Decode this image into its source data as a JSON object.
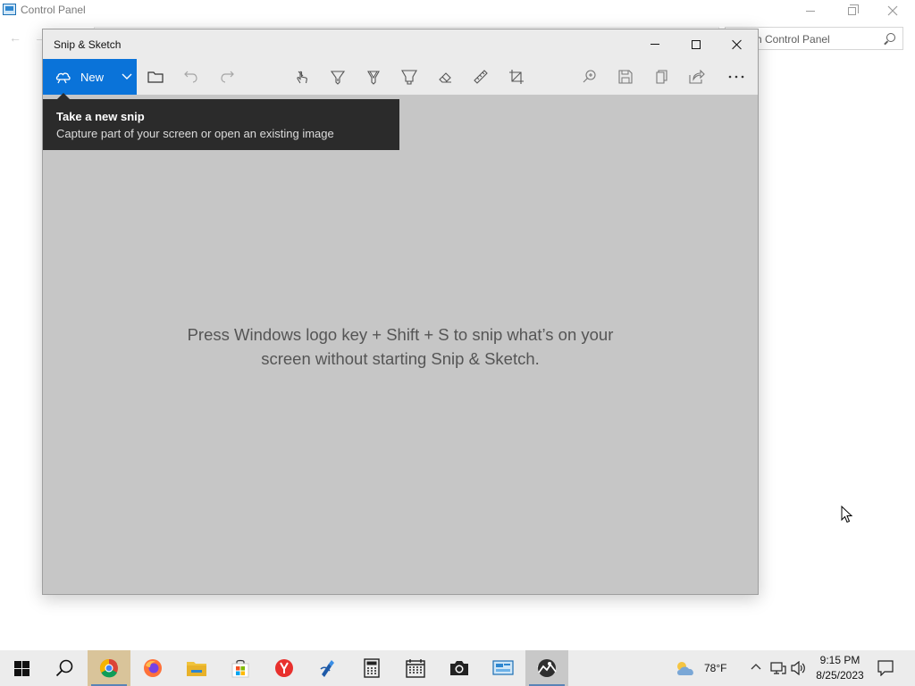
{
  "background_window": {
    "title": "Control Panel",
    "search_placeholder": "h Control Panel"
  },
  "window": {
    "title": "Snip & Sketch",
    "controls": [
      "minimize-icon",
      "maximize-icon",
      "close-icon"
    ]
  },
  "toolbar": {
    "new_label": "New",
    "icons": [
      "new-snip-icon",
      "chevron-down-icon",
      "open-folder-icon",
      "undo-icon",
      "redo-icon",
      "touch-writing-icon",
      "ballpoint-pen-icon",
      "pencil-icon",
      "highlighter-icon",
      "eraser-icon",
      "ruler-icon",
      "crop-icon",
      "zoom-icon",
      "save-icon",
      "copy-icon",
      "share-icon",
      "more-icon"
    ]
  },
  "tooltip": {
    "title": "Take a new snip",
    "description": "Capture part of your screen or open an existing image"
  },
  "canvas": {
    "hint_line1": "Press Windows logo key + Shift + S to snip what’s on your",
    "hint_line2": "screen without starting Snip & Sketch."
  },
  "taskbar": {
    "apps": [
      "windows-start-icon",
      "search-icon",
      "chrome-icon",
      "firefox-icon",
      "file-explorer-icon",
      "microsoft-store-icon",
      "yandex-browser-icon",
      "app-icon",
      "calculator-icon",
      "calendar-icon",
      "camera-icon",
      "control-panel-icon",
      "snip-and-sketch-icon"
    ],
    "weather_temp": "78°F",
    "time": "9:15 PM",
    "date": "8/25/2023"
  },
  "colors": {
    "accent": "#0a73d9",
    "canvas": "#c6c6c6",
    "tooltip_bg": "#2b2b2b",
    "taskbar": "#ececec"
  }
}
